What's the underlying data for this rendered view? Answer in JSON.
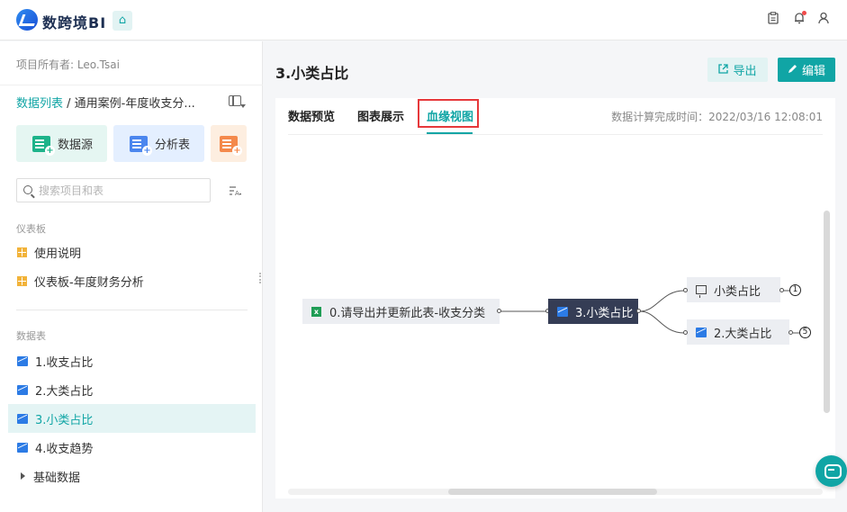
{
  "header": {
    "brand": "数跨境BI",
    "home_icon": "⌂",
    "icons": [
      "clipboard-icon",
      "bell-icon",
      "user-icon"
    ]
  },
  "sidebar": {
    "owner": "项目所有者: Leo.Tsai",
    "breadcrumb": {
      "root": "数据列表",
      "sep": " / ",
      "current": "通用案例-年度收支分..."
    },
    "tiles": {
      "datasource": "数据源",
      "analysis": "分析表"
    },
    "search": {
      "placeholder": "搜索项目和表"
    },
    "dashboards": {
      "label": "仪表板",
      "items": [
        "使用说明",
        "仪表板-年度财务分析"
      ]
    },
    "datasets": {
      "label": "数据表",
      "items": [
        "1.收支占比",
        "2.大类占比",
        "3.小类占比",
        "4.收支趋势"
      ],
      "active_index": 2,
      "folder": "基础数据"
    }
  },
  "main": {
    "title": "3.小类占比",
    "export_label": "导出",
    "edit_label": "编辑",
    "tabs": [
      "数据预览",
      "图表展示",
      "血缘视图"
    ],
    "active_tab": "血缘视图",
    "calc_time": "数据计算完成时间：2022/03/16 12:08:01"
  },
  "lineage": {
    "source": "0.请导出并更新此表-收支分类",
    "center": "3.小类占比",
    "outputs": [
      {
        "label": "小类占比",
        "count": "1",
        "icon": "dashboard-icon"
      },
      {
        "label": "2.大类占比",
        "count": "5",
        "icon": "chart-icon"
      }
    ]
  },
  "colors": {
    "accent": "#10a5a5",
    "highlight": "#e6383b",
    "center_node": "#353d55"
  }
}
